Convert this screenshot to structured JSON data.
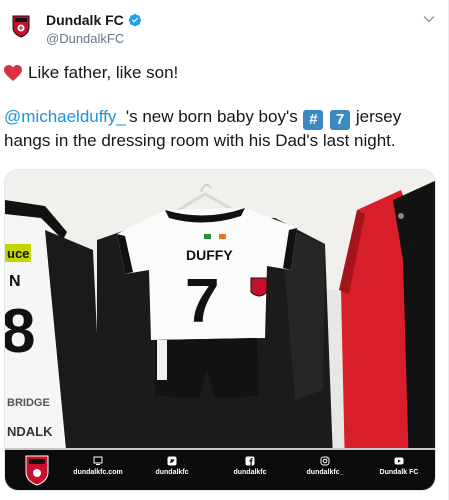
{
  "tweet": {
    "display_name": "Dundalk FC",
    "handle": "@DundalkFC",
    "line1": "Like father, like son!",
    "mention": "@michaelduffy_",
    "line2_rest_a": "'s new born baby boy's ",
    "keycap_hash": "#",
    "keycap_seven": "7",
    "line2_rest_b": " jersey",
    "line3": "hangs in the dressing room with his Dad's last night."
  },
  "photo": {
    "jersey_name": "DUFFY",
    "jersey_number": "7",
    "left_shirt_sponsor": "uce",
    "left_shirt_letter": "N",
    "left_shirt_number": "8",
    "left_shirt_brand": "BRIDGE",
    "left_shirt_town": "NDALK",
    "bottom_bar": [
      {
        "icon": "website-icon",
        "label": "dundalkfc.com"
      },
      {
        "icon": "twitter-icon",
        "label": "dundalkfc"
      },
      {
        "icon": "facebook-icon",
        "label": "dundalkfc"
      },
      {
        "icon": "instagram-icon",
        "label": "dundalkfc_"
      },
      {
        "icon": "youtube-icon",
        "label": "Dundalk FC"
      }
    ]
  },
  "colors": {
    "mention": "#1b95e0",
    "verified": "#1da1f2",
    "heart": "#e0245e",
    "keycap": "#3b88c3"
  }
}
